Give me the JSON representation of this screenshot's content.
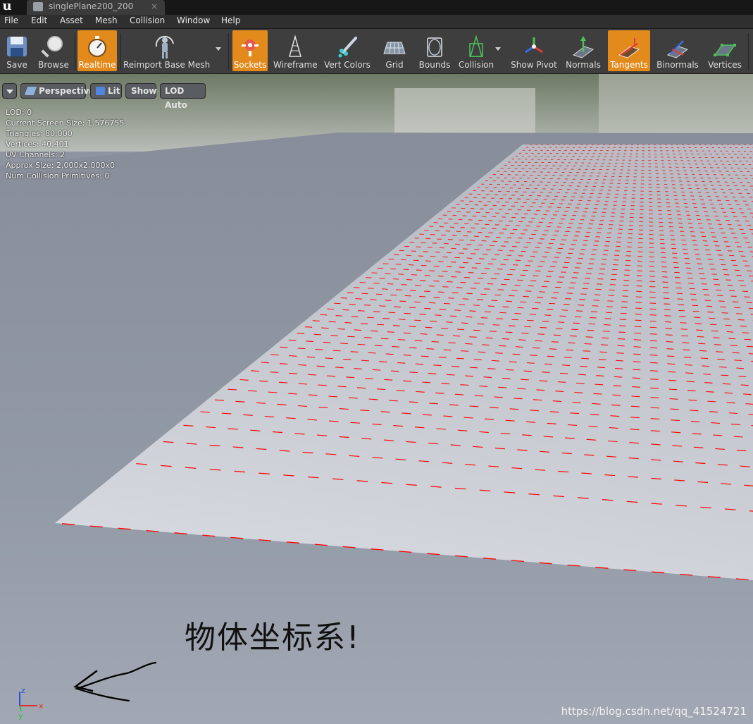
{
  "window": {
    "logo": "u",
    "tab_title": "singlePlane200_200",
    "tab_close": "×"
  },
  "menu": {
    "items": [
      "File",
      "Edit",
      "Asset",
      "Mesh",
      "Collision",
      "Window",
      "Help"
    ]
  },
  "toolbar": {
    "buttons": [
      {
        "label": "Save",
        "icon": "save-icon",
        "active": false
      },
      {
        "label": "Browse",
        "icon": "browse-icon",
        "active": false
      },
      {
        "label": "Realtime",
        "icon": "stopwatch-icon",
        "active": true
      },
      {
        "label": "Reimport Base Mesh",
        "icon": "reimport-icon",
        "active": false
      },
      {
        "label": "Sockets",
        "icon": "sockets-icon",
        "active": true
      },
      {
        "label": "Wireframe",
        "icon": "wireframe-icon",
        "active": false
      },
      {
        "label": "Vert Colors",
        "icon": "vert-colors-icon",
        "active": false
      },
      {
        "label": "Grid",
        "icon": "grid-icon",
        "active": false
      },
      {
        "label": "Bounds",
        "icon": "bounds-icon",
        "active": false
      },
      {
        "label": "Collision",
        "icon": "collision-icon",
        "active": false
      },
      {
        "label": "Show Pivot",
        "icon": "pivot-icon",
        "active": false
      },
      {
        "label": "Normals",
        "icon": "normals-icon",
        "active": false
      },
      {
        "label": "Tangents",
        "icon": "tangents-icon",
        "active": true
      },
      {
        "label": "Binormals",
        "icon": "binormals-icon",
        "active": false
      },
      {
        "label": "Vertices",
        "icon": "vertices-icon",
        "active": false
      }
    ],
    "accent_color": "#e38a1c"
  },
  "viewport": {
    "perspective_label": "Perspective",
    "lit_label": "Lit",
    "show_label": "Show",
    "lod_label": "LOD Auto",
    "stats": [
      "LOD:  0",
      "Current Screen Size:  1.576755",
      "Triangles:  80,000",
      "Vertices:  40,401",
      "UV Channels:  2",
      "Approx Size: 2,000x2,000x0",
      "Num Collision Primitives:  0"
    ],
    "annotation_text": "物体坐标系!",
    "watermark": "https://blog.csdn.net/qq_41524721",
    "axis_labels": {
      "x": "x",
      "y": "y",
      "z": "z"
    },
    "tangent_color": "#ff0000"
  }
}
